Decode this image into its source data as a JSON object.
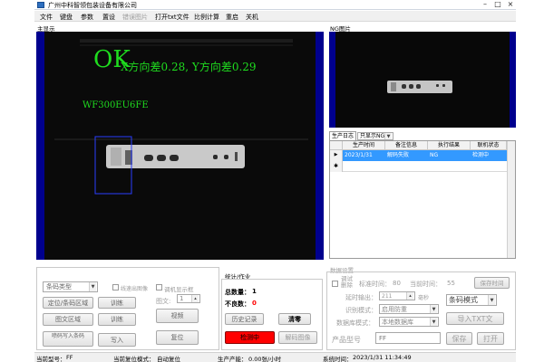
{
  "window": {
    "title": "广州中科智领包装设备有限公司"
  },
  "menu": [
    {
      "label": "文件",
      "enabled": true
    },
    {
      "label": "键盘",
      "enabled": true
    },
    {
      "label": "参数",
      "enabled": true
    },
    {
      "label": "置设",
      "enabled": true
    },
    {
      "label": "错误图片",
      "enabled": false
    },
    {
      "label": "打开txt文件",
      "enabled": true
    },
    {
      "label": "比例计算",
      "enabled": true
    },
    {
      "label": "重启",
      "enabled": true
    },
    {
      "label": "关机",
      "enabled": true
    }
  ],
  "main_display": {
    "label": "主显示",
    "overlay_status": "OK",
    "overlay_deviation": "X方向差0.28, Y方向差0.29",
    "overlay_code": "WF300EU6FE"
  },
  "ng_display": {
    "label": "NG图片"
  },
  "log": {
    "tab_label": "生产日志",
    "filter_value": "只显示NG",
    "columns": [
      "生产时间",
      "备注信息",
      "执行结果",
      "联机状态"
    ],
    "rows": [
      {
        "time": "2023/1/31",
        "note": "解码失败",
        "result": "NG",
        "status": "检测中",
        "selected": true
      }
    ]
  },
  "left_controls": {
    "mode_combo": "条码类型",
    "chk_line_image": "线速出图像",
    "chk_relay_display": "调机显示框",
    "btn_locate_region": "定位/条码区域",
    "btn_train_1": "训练",
    "text_label": "图文:",
    "text_spin_value": "1",
    "btn_text_region": "图文区域",
    "btn_train_2": "训练",
    "btn_video": "视频",
    "btn_write_barcode": "喷码写入条码",
    "btn_write": "写入",
    "btn_reset": "复位"
  },
  "stats": {
    "group_label": "统计/作业",
    "total_label": "总数量：",
    "total_value": "1",
    "bad_label": "不良数：",
    "bad_value": "0",
    "btn_history": "历史记录",
    "btn_clear": "清零",
    "btn_detecting": "检测中",
    "btn_decode_image": "解码图像"
  },
  "data_settings": {
    "group_label": "数据设置",
    "chk_debug": "调试删除",
    "std_time_label": "标准时间：",
    "std_time_value": "80",
    "current_time_label": "当前时间：",
    "current_time_value": "55",
    "btn_save_time": "保存时间",
    "delay_output_label": "延时输出：",
    "delay_output_value": "211",
    "delay_unit": "毫秒",
    "mode_combo": "条码模式",
    "recog_mode_label": "识别模式：",
    "recog_mode_value": "启用防重",
    "db_mode_label": "数据库模式：",
    "db_mode_value": "本地数据库",
    "btn_import": "导入TXT文",
    "product_label": "产品型号",
    "product_value": "FF",
    "btn_save": "保存",
    "btn_open": "打开"
  },
  "status_bar": {
    "model_label": "当前型号：",
    "model_value": "FF",
    "reset_mode_label": "当前复位模式：",
    "reset_mode_value": "自动复位",
    "capacity_label": "生产产能：",
    "capacity_value": "0.00张/小时",
    "time_label": "系统时间：",
    "time_value": "2023/1/31 11:34:49"
  },
  "colors": {
    "overlay_text": "#1fdc1f",
    "blue_band": "#00008e",
    "detecting_red": "#ff0000",
    "selected_row": "#3399ff"
  }
}
